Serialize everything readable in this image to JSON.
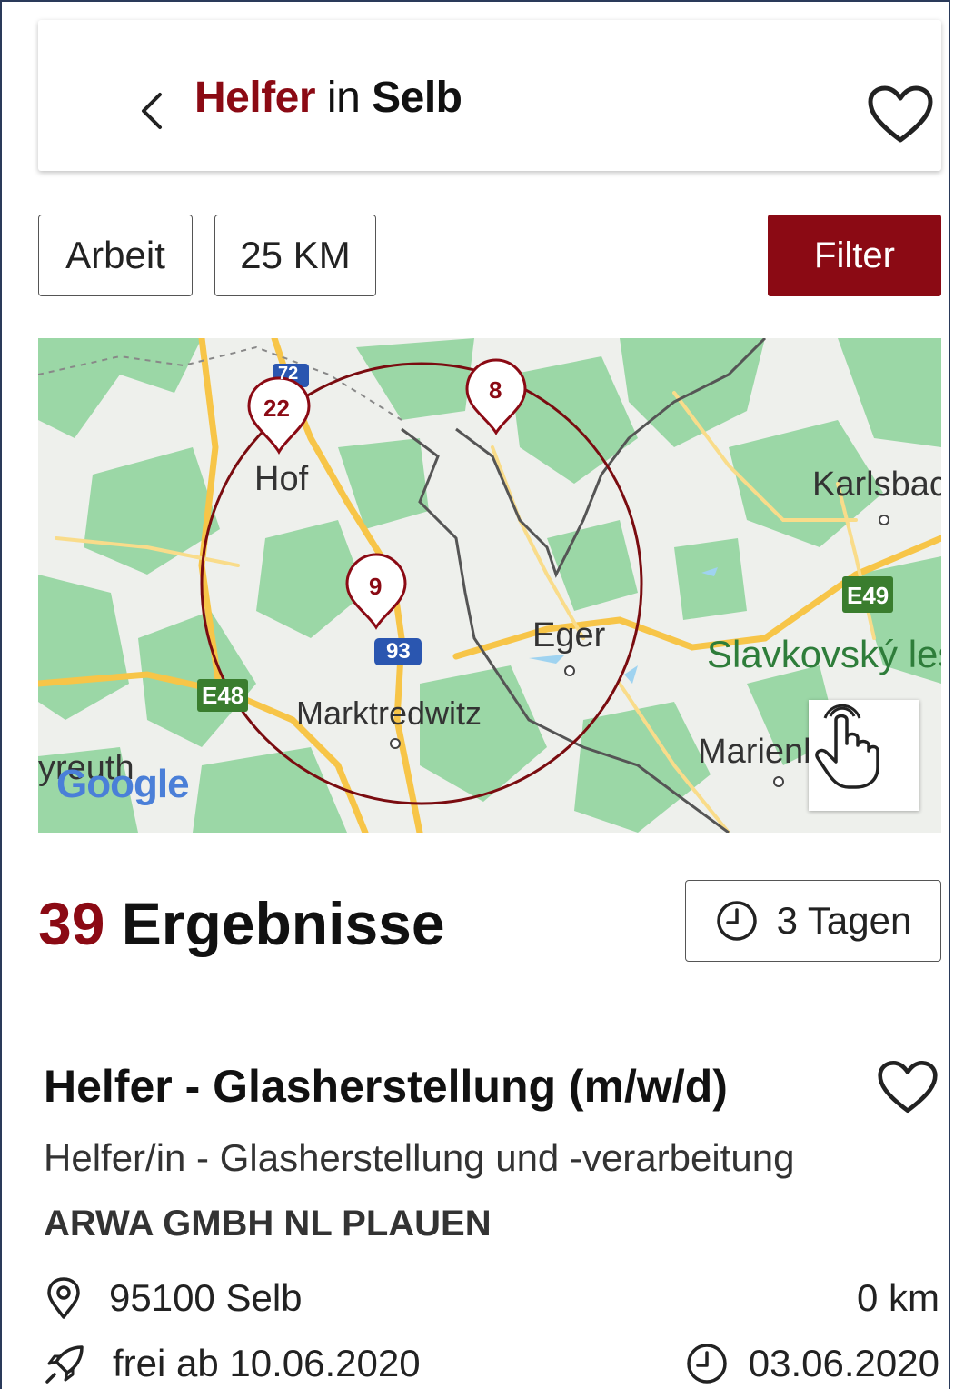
{
  "header": {
    "keyword": "Helfer",
    "in_word": "in",
    "location": "Selb"
  },
  "filters": {
    "type_label": "Arbeit",
    "radius_label": "25 KM",
    "filter_button": "Filter"
  },
  "map": {
    "cities": {
      "hof": "Hof",
      "karlsbad": "Karlsbac",
      "eger": "Eger",
      "marktredwitz": "Marktredwitz",
      "slavkovsky": "Slavkovský les",
      "marienbad": "Marienb",
      "bayreuth": "yreuth"
    },
    "roads": {
      "a72": "72",
      "a93": "93",
      "e48": "E48",
      "e49": "E49"
    },
    "clusters": [
      "22",
      "8",
      "9"
    ],
    "google_logo": "Google",
    "colors": {
      "circle": "#7a0c10",
      "marker": "#8b0a14",
      "water": "#9fd3f0",
      "green": "#9bd7a6"
    }
  },
  "results": {
    "count": "39",
    "label": "Ergebnisse",
    "time_filter": "3 Tagen"
  },
  "job": {
    "title": "Helfer - Glasherstellung (m/w/d)",
    "subtitle": "Helfer/in - Glasherstellung und -verarbeitung",
    "company": "ARWA GMBH NL PLAUEN",
    "location": "95100 Selb",
    "distance": "0 km",
    "available_from": "frei ab 10.06.2020",
    "posted_date": "03.06.2020"
  },
  "icons": [
    "back-icon",
    "heart-icon",
    "clock-icon",
    "location-pin-icon",
    "rocket-icon",
    "touch-hand-icon"
  ],
  "colors": {
    "brand": "#8b0a14"
  }
}
